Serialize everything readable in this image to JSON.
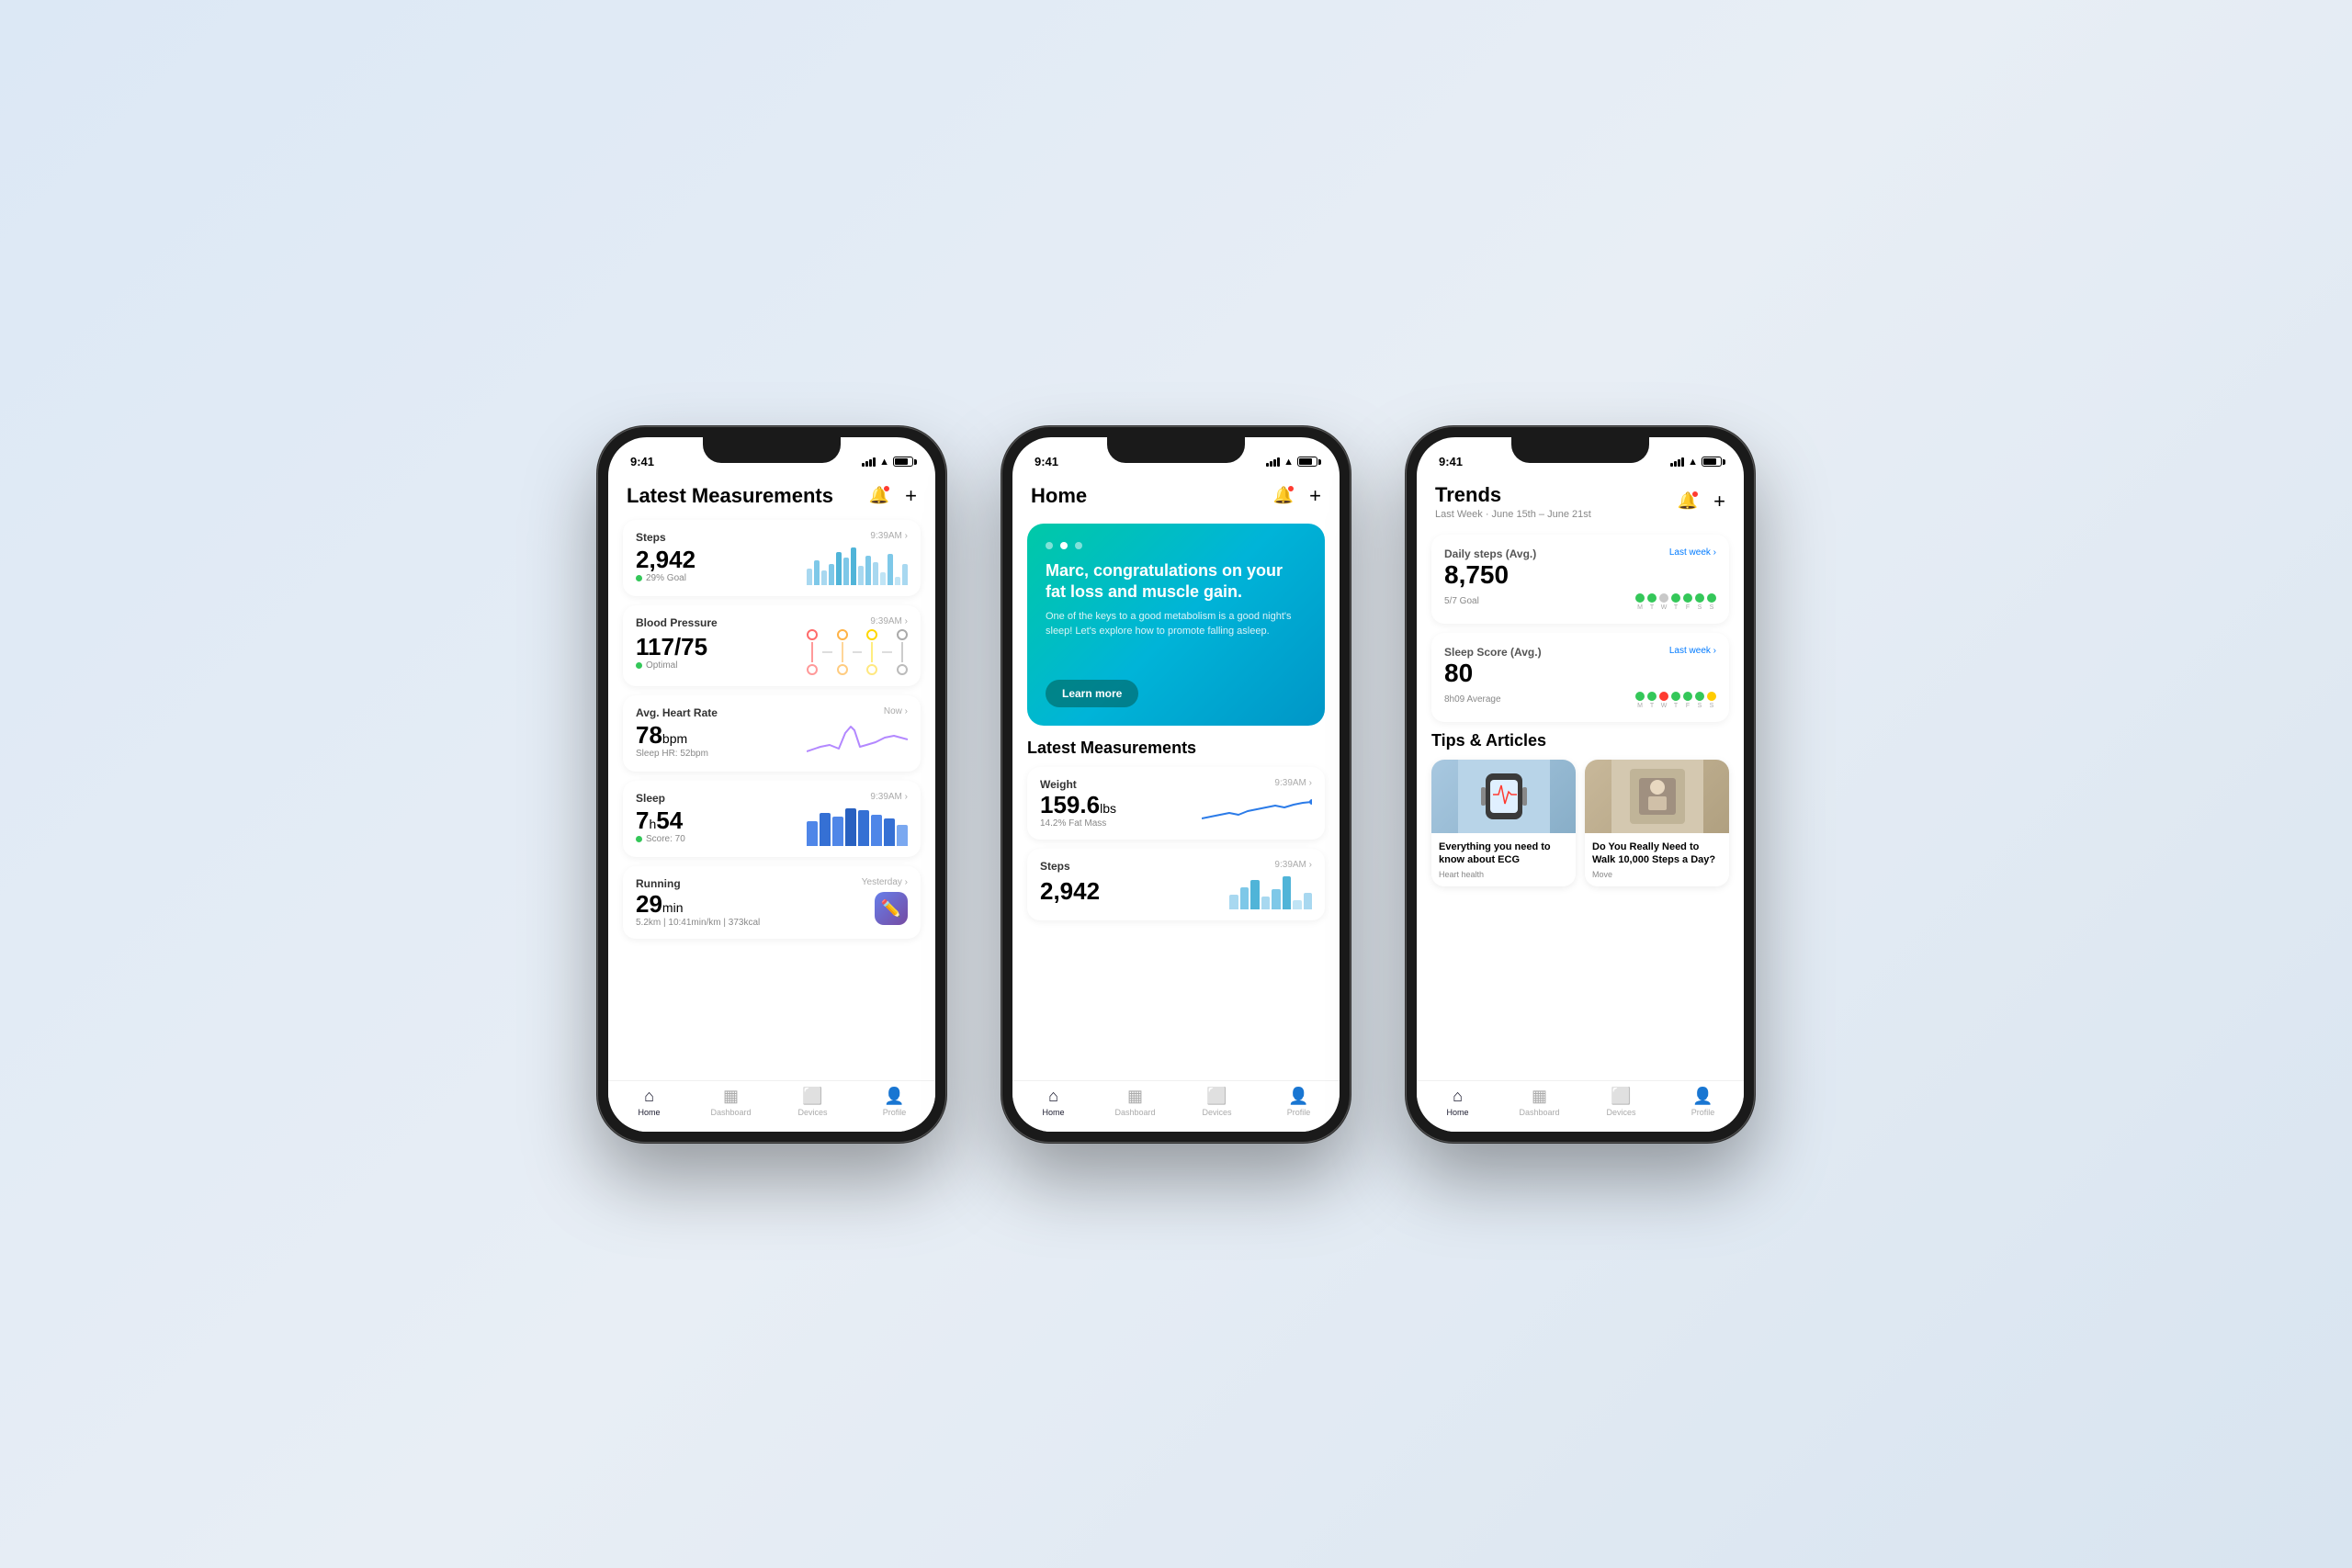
{
  "background": "#dce8f5",
  "phones": [
    {
      "id": "phone1",
      "status": {
        "time": "9:41",
        "battery": 75
      },
      "screen": "measurements",
      "title": "Latest Measurements",
      "nav": {
        "bell": true,
        "plus": true
      },
      "measurements": [
        {
          "title": "Steps",
          "time": "9:39AM",
          "value": "2,942",
          "unit": "",
          "sub": "29% Goal",
          "subColor": "green",
          "chart": "bars-blue"
        },
        {
          "title": "Blood Pressure",
          "time": "9:39AM",
          "value": "117/75",
          "unit": "",
          "sub": "Optimal",
          "subColor": "green",
          "chart": "bp"
        },
        {
          "title": "Avg. Heart Rate",
          "time": "Now",
          "value": "78",
          "unit": "bpm",
          "sub": "Sleep HR: 52bpm",
          "subColor": "none",
          "chart": "hr-line"
        },
        {
          "title": "Sleep",
          "time": "9:39AM",
          "value": "7h54",
          "unit": "",
          "sub": "Score: 70",
          "subColor": "green",
          "chart": "sleep-bars"
        },
        {
          "title": "Running",
          "time": "Yesterday",
          "value": "29",
          "unit": "min",
          "sub": "5.2km | 10:41min/km | 373kcal",
          "subColor": "none",
          "chart": "running"
        }
      ],
      "tabs": [
        {
          "label": "Home",
          "icon": "🏠",
          "active": true
        },
        {
          "label": "Dashboard",
          "icon": "📊",
          "active": false
        },
        {
          "label": "Devices",
          "icon": "📱",
          "active": false
        },
        {
          "label": "Profile",
          "icon": "👤",
          "active": false
        }
      ]
    },
    {
      "id": "phone2",
      "status": {
        "time": "9:41",
        "battery": 75
      },
      "screen": "home",
      "title": "Home",
      "nav": {
        "bell": true,
        "plus": true
      },
      "hero": {
        "dots": 3,
        "activeDot": 1,
        "title": "Marc, congratulations on your fat loss and muscle gain.",
        "subtitle": "One of the keys to a good metabolism is a good night's sleep! Let's explore how to promote falling asleep.",
        "button": "Learn more"
      },
      "sectionTitle": "Latest Measurements",
      "measurements": [
        {
          "title": "Weight",
          "time": "9:39AM",
          "value": "159.6",
          "unit": "lbs",
          "sub": "14.2% Fat Mass",
          "chart": "weight-line"
        },
        {
          "title": "Steps",
          "time": "9:39AM",
          "value": "2,942",
          "unit": "",
          "sub": "",
          "chart": "steps-bars"
        }
      ],
      "tabs": [
        {
          "label": "Home",
          "icon": "🏠",
          "active": true
        },
        {
          "label": "Dashboard",
          "icon": "📊",
          "active": false
        },
        {
          "label": "Devices",
          "icon": "📱",
          "active": false
        },
        {
          "label": "Profile",
          "icon": "👤",
          "active": false
        }
      ]
    },
    {
      "id": "phone3",
      "status": {
        "time": "9:41",
        "battery": 75
      },
      "screen": "trends",
      "title": "Trends",
      "subtitle": "Last Week · June 15th – June 21st",
      "nav": {
        "bell": true,
        "plus": true
      },
      "trends": [
        {
          "title": "Daily steps (Avg.)",
          "link": "Last week",
          "value": "8,750",
          "sub": "5/7 Goal",
          "dots": [
            "green",
            "green",
            "gray",
            "green",
            "green",
            "green",
            "green"
          ],
          "labels": [
            "M",
            "T",
            "W",
            "T",
            "F",
            "S",
            "S"
          ]
        },
        {
          "title": "Sleep Score (Avg.)",
          "link": "Last week",
          "value": "80",
          "sub": "8h09 Average",
          "dots": [
            "green",
            "green",
            "red",
            "green",
            "green",
            "green",
            "yellow"
          ],
          "labels": [
            "M",
            "T",
            "W",
            "T",
            "F",
            "S",
            "S"
          ]
        }
      ],
      "tipsTitle": "Tips & Articles",
      "tips": [
        {
          "title": "Everything you need to know about ECG",
          "category": "Heart health",
          "bgColor": "#b8d4e8"
        },
        {
          "title": "Do You Really Need to Walk 10,000 Steps a Day?",
          "category": "Move",
          "bgColor": "#d4c8b8"
        }
      ],
      "tabs": [
        {
          "label": "Home",
          "icon": "🏠",
          "active": true
        },
        {
          "label": "Dashboard",
          "icon": "📊",
          "active": false
        },
        {
          "label": "Devices",
          "icon": "📱",
          "active": false
        },
        {
          "label": "Profile",
          "icon": "👤",
          "active": false
        }
      ]
    }
  ]
}
